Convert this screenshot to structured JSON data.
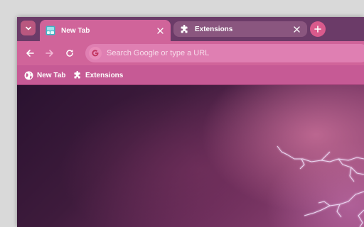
{
  "browser": {
    "tabs": [
      {
        "title": "New Tab",
        "active": true,
        "favicon": "new-tab-icon",
        "close_glyph": "✕"
      },
      {
        "title": "Extensions",
        "active": false,
        "favicon": "puzzle-piece-icon",
        "close_glyph": "✕"
      }
    ],
    "tab_search_glyph": "chevron-down-icon",
    "new_tab_glyph": "+"
  },
  "toolbar": {
    "back_icon": "arrow-left-icon",
    "forward_icon": "arrow-right-icon",
    "reload_icon": "reload-icon",
    "search_engine_badge": "G",
    "omnibox_placeholder": "Search Google or type a URL",
    "omnibox_value": ""
  },
  "bookmarks": {
    "items": [
      {
        "label": "New Tab",
        "icon": "globe-icon"
      },
      {
        "label": "Extensions",
        "icon": "puzzle-piece-icon"
      }
    ]
  },
  "colors": {
    "tabstrip": "#6b3b68",
    "active_tab": "#d0649a",
    "toolbar": "#d0649a",
    "omnibox": "#df7fb2",
    "bookmarks_bar": "#c65a95",
    "accent": "#d95a8c"
  }
}
